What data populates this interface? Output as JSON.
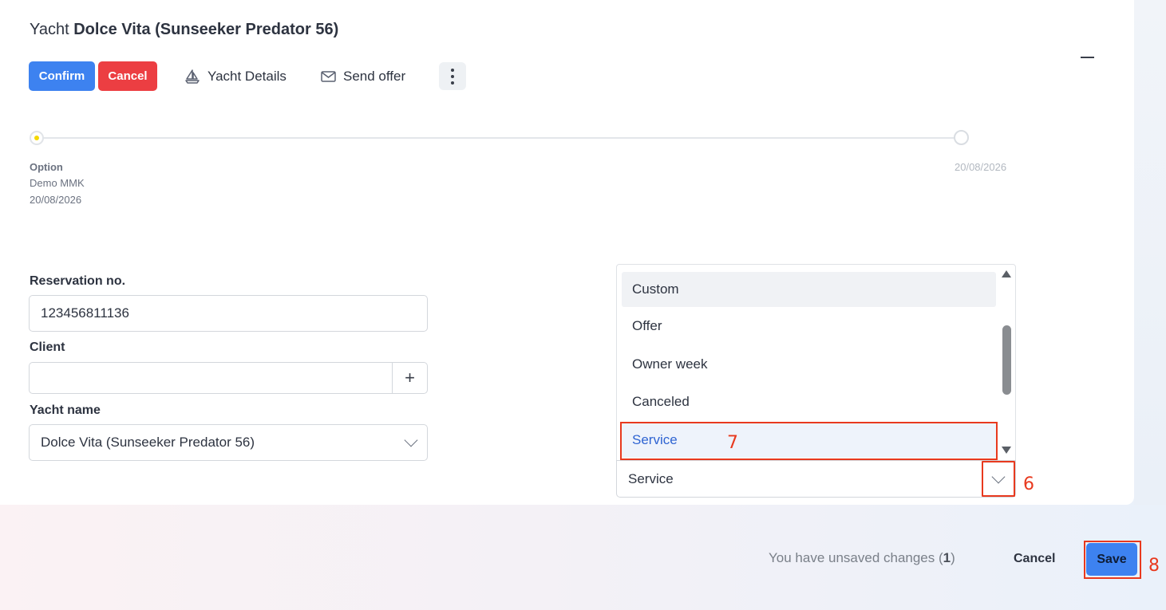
{
  "header": {
    "title_prefix": "Yacht",
    "title_name": "Dolce Vita (Sunseeker Predator 56)"
  },
  "toolbar": {
    "confirm_label": "Confirm",
    "cancel_label": "Cancel",
    "yacht_details_label": "Yacht Details",
    "send_offer_label": "Send offer",
    "yacht_icon": "sailboat-icon",
    "send_icon": "envelope-icon",
    "more_icon": "more-vertical-icon",
    "minimize_icon": "minimize-icon"
  },
  "timeline": {
    "start_title": "Option",
    "start_user": "Demo MMK",
    "start_date": "20/08/2026",
    "end_date": "20/08/2026",
    "current_color": "#f5d800"
  },
  "form": {
    "reservation_label": "Reservation no.",
    "reservation_value": "123456811136",
    "client_label": "Client",
    "client_value": "",
    "client_add_label": "+",
    "yacht_label": "Yacht name",
    "yacht_value": "Dolce Vita (Sunseeker Predator 56)"
  },
  "status_dropdown": {
    "options": [
      "Custom",
      "Offer",
      "Owner week",
      "Canceled",
      "Service"
    ],
    "hovered": "Custom",
    "selected": "Service",
    "current_value": "Service"
  },
  "annotations": {
    "step_6": "6",
    "step_7": "7",
    "step_8": "8",
    "color": "#e8391e"
  },
  "footer": {
    "unsaved_text": "You have unsaved changes (",
    "unsaved_count": "1",
    "unsaved_suffix": ")",
    "cancel_label": "Cancel",
    "save_label": "Save"
  },
  "colors": {
    "primary": "#3d82f0",
    "danger": "#ec3e42",
    "selected_text": "#2f64d2"
  }
}
